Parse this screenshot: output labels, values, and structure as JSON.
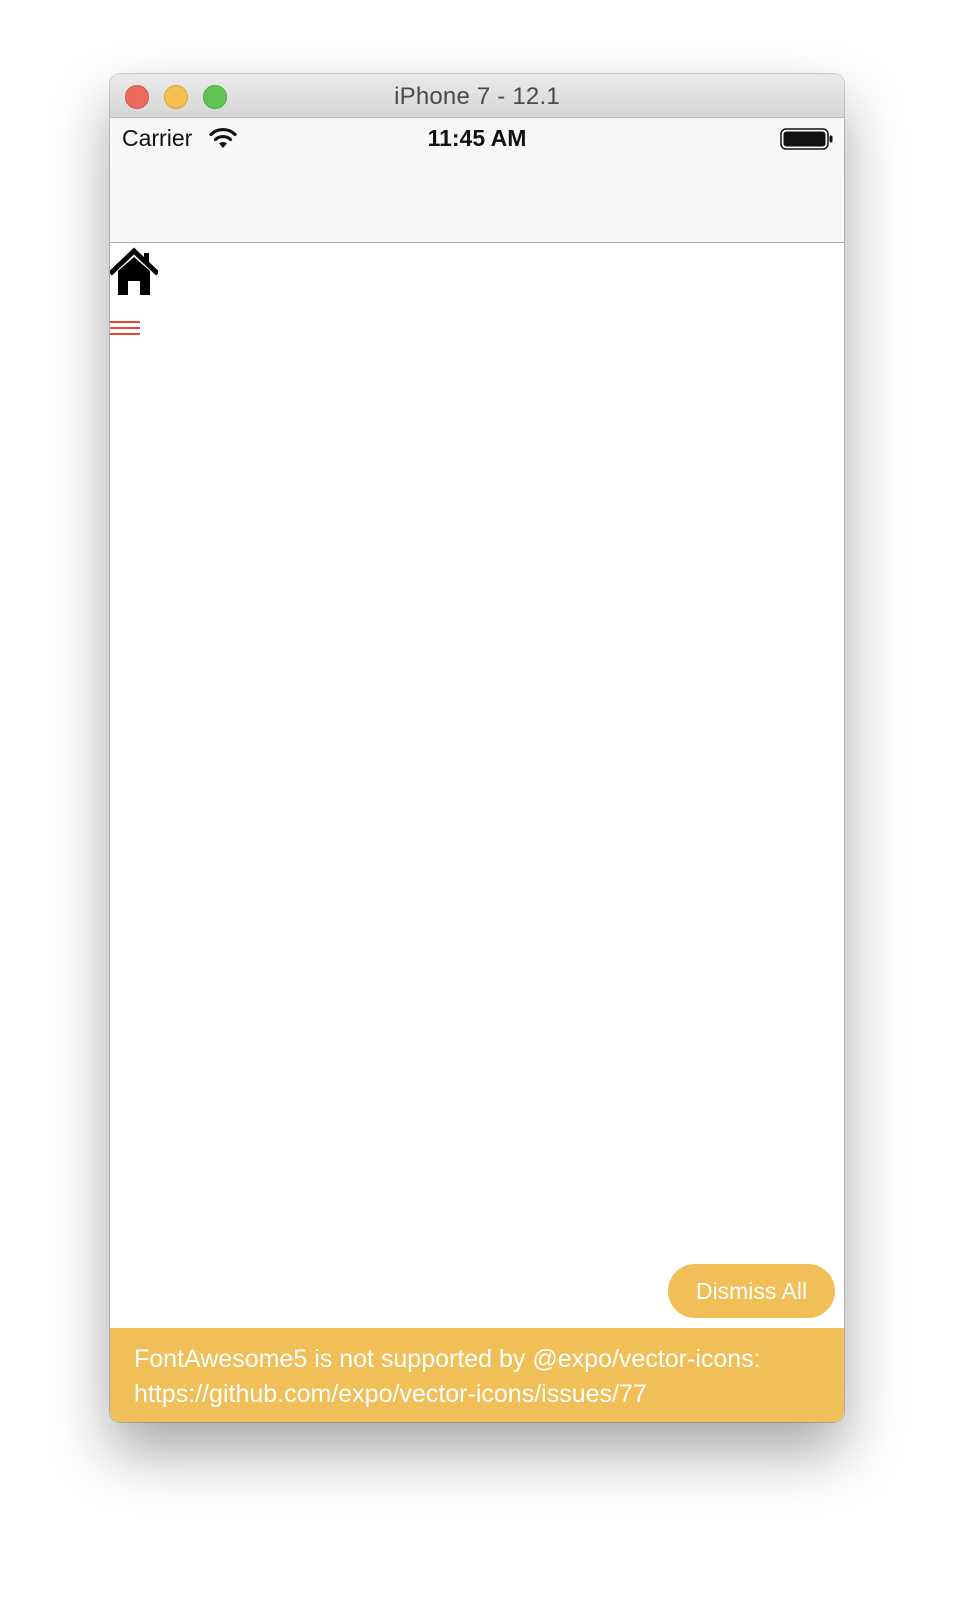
{
  "window": {
    "title": "iPhone 7 - 12.1"
  },
  "status_bar": {
    "carrier": "Carrier",
    "time": "11:45 AM"
  },
  "content": {
    "home_icon": "home-icon",
    "menu_icon": "menu-icon"
  },
  "toast": {
    "dismiss_label": "Dismiss All",
    "message": "FontAwesome5 is not supported by @expo/vector-icons: https://github.com/expo/vector-icons/issues/77"
  },
  "colors": {
    "warning": "#f0bf57",
    "menu_icon": "#e8463b"
  }
}
